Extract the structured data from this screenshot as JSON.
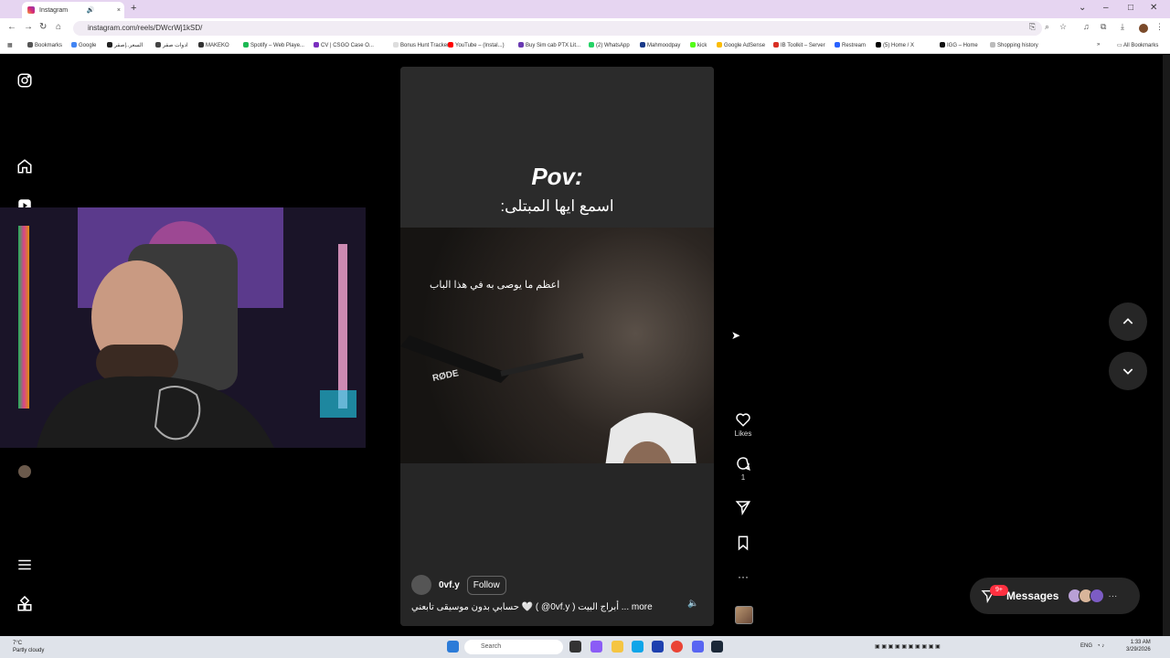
{
  "browser": {
    "tab_title": "Instagram",
    "tab_audio_icon": "speaker-icon",
    "tab_close": "×",
    "new_tab": "+",
    "url": "instagram.com/reels/DWcrWj1kSD/",
    "window_controls": [
      "⌄",
      "–",
      "□",
      "✕"
    ]
  },
  "bookmarks": [
    {
      "label": "Bookmarks",
      "color": "#555555"
    },
    {
      "label": "Google",
      "color": "#4285f4"
    },
    {
      "label": "السعر..|صقر",
      "color": "#222222"
    },
    {
      "label": "ادوات صقر",
      "color": "#444444"
    },
    {
      "label": "MAKEKO",
      "color": "#333333"
    },
    {
      "label": "Spotify – Web Playe...",
      "color": "#1db954"
    },
    {
      "label": "CV | CSGO Case O...",
      "color": "#7b2fbf"
    },
    {
      "label": "Bonus Hunt Tracker",
      "color": "#dddddd"
    },
    {
      "label": "YouTube – (Instal...)",
      "color": "#ff0000"
    },
    {
      "label": "Buy Sim cab PTX Lit...",
      "color": "#6a3ab2"
    },
    {
      "label": "(2) WhatsApp",
      "color": "#25d366"
    },
    {
      "label": "Mahmoodpay",
      "color": "#1a3a8a"
    },
    {
      "label": "kick",
      "color": "#53fc18"
    },
    {
      "label": "Google AdSense",
      "color": "#fbbc04"
    },
    {
      "label": "IB Toolkit – Server",
      "color": "#d93025"
    },
    {
      "label": "Restream",
      "color": "#2962ff"
    },
    {
      "label": "(5) Home / X",
      "color": "#000000"
    },
    {
      "label": "IGG – Home",
      "color": "#111111"
    },
    {
      "label": "Shopping history",
      "color": "#bbbbbb"
    }
  ],
  "bookmarks_more": "»",
  "all_bookmarks": "All Bookmarks",
  "reel": {
    "pov_text": "Pov:",
    "arabic_title": "اسمع ايها المبتلى:",
    "overlay_quote": "اعظم ما يوصى به في هذا الباب",
    "mic_brand": "RØDE",
    "username": "0vf.y",
    "follow_label": "Follow",
    "caption": "حسابي بدون موسيقى تابعني 🤍 ( @0vf.y ) أبراج البيت ... more"
  },
  "actions": {
    "likes_label": "Likes",
    "comments_count": "1",
    "more": "···"
  },
  "messages": {
    "label": "Messages",
    "badge": "9+",
    "more": "···"
  },
  "taskbar": {
    "weather_temp": "7°C",
    "weather_desc": "Partly cloudy",
    "search_placeholder": "Search",
    "language": "ENG",
    "time": "1:33 AM",
    "date": "3/29/2026"
  },
  "colors": {
    "accent": "#ff3040",
    "background": "#000000",
    "surface": "#262626"
  }
}
